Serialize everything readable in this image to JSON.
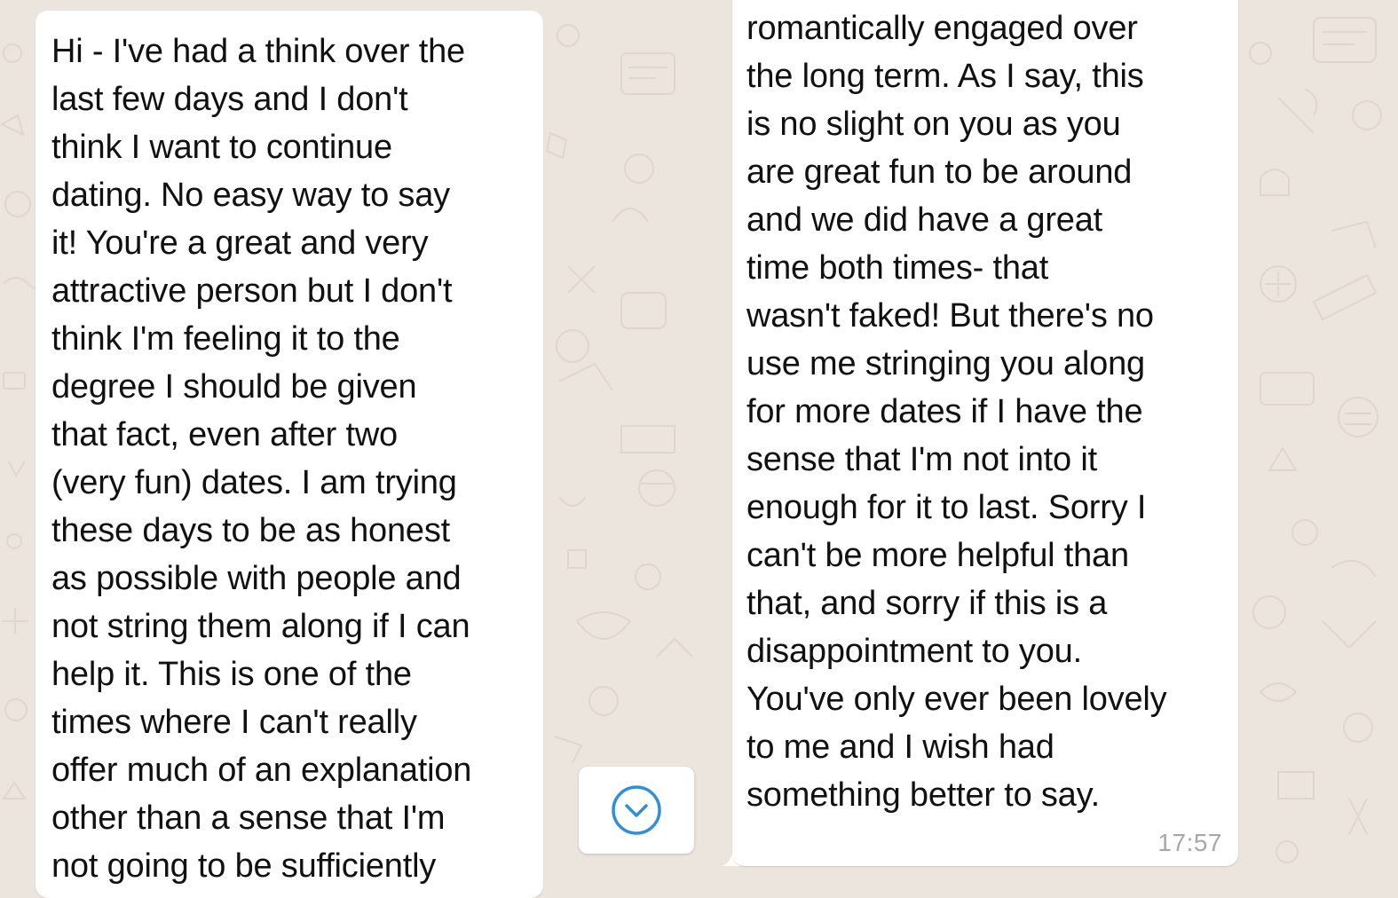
{
  "chat": {
    "incoming_message_part1": {
      "lines": [
        "Hi - I've had a think over the",
        "last few days and I don't",
        "think I want to continue",
        "dating. No easy way to say",
        "it! You're a great and very",
        "attractive person but I don't",
        "think I'm feeling it to the",
        "degree I should be given",
        "that fact, even after two",
        "(very fun) dates. I am trying",
        "these days to be as honest",
        "as possible with people and",
        "not string them along if I can",
        "help it. This is one of the",
        "times where I can't really",
        "offer much of an explanation",
        "other than a sense that I'm",
        "not going to be sufficiently"
      ]
    },
    "incoming_message_part2": {
      "lines": [
        "romantically engaged over",
        "the long term. As I say, this",
        "is no slight on you as you",
        "are great fun to be around",
        "and we did have a great",
        "time both times-  that",
        "wasn't faked! But there's no",
        "use me stringing you along",
        "for more dates if I have the",
        "sense that I'm not into it",
        "enough for it to last. Sorry I",
        "can't be more helpful than",
        "that, and sorry if this is a",
        "disappointment to you.",
        "You've only ever been lovely",
        "to me and I wish had",
        "something better to say."
      ],
      "timestamp": "17:57"
    },
    "scroll_down_button": {
      "icon": "chevron-down-circle-icon"
    }
  },
  "colors": {
    "wallpaper": "#ece5dd",
    "bubble": "#ffffff",
    "text": "#111111",
    "timestamp": "#a7a7a7",
    "accent": "#2f8fd8"
  }
}
